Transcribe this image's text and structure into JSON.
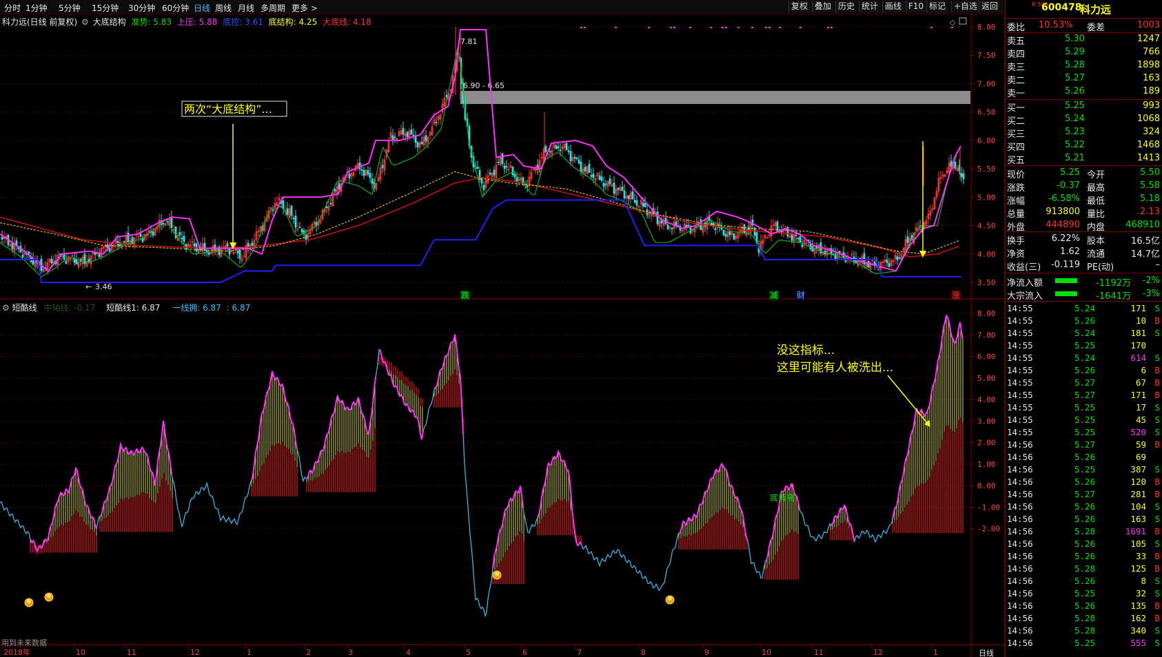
{
  "toolbar": {
    "periods": [
      "分时",
      "1分钟",
      "5分钟",
      "15分钟",
      "30分钟",
      "60分钟",
      "日线",
      "周线",
      "月线",
      "多周期",
      "更多 >"
    ],
    "active_period": "日线",
    "right_buttons": [
      "复权",
      "叠加",
      "历史",
      "统计",
      "画线",
      "F10",
      "标记",
      "+自选",
      "返回"
    ]
  },
  "main_chart": {
    "title": "科力远(日线 前复权)",
    "indicator_name": "大底结构",
    "indicators": [
      {
        "label": "准势: 5.83",
        "color": "#00e000"
      },
      {
        "label": "上压: 5.88",
        "color": "#ff30ff"
      },
      {
        "label": "底控: 3.61",
        "color": "#3050ff"
      },
      {
        "label": "底结构: 4.25",
        "color": "#ffff00"
      },
      {
        "label": "大底线: 4.18",
        "color": "#ff3030"
      }
    ],
    "price_axis": [
      "8.00",
      "7.50",
      "7.00",
      "6.50",
      "6.00",
      "5.50",
      "5.00",
      "4.50",
      "4.00",
      "3.50"
    ],
    "annotation_box": "两次“大底结构”...",
    "high_label": "7.81",
    "low_label": "3.46",
    "zone_label": "6.90 - 6.65",
    "event_labels": [
      "跌",
      "减",
      "财",
      "涨"
    ]
  },
  "sub_chart": {
    "name": "短酷线",
    "legend": [
      {
        "label": "中轴线: -0.17",
        "color": "#2a4a2a"
      },
      {
        "label": "短酷线1: 6.87",
        "color": "#e6e6e6"
      },
      {
        "label": "一线拥: 6.87",
        "color": "#30c0ff"
      },
      {
        "label": ": 6.87",
        "color": "#30c0ff"
      }
    ],
    "axis": [
      "8.00",
      "7.00",
      "6.00",
      "5.00",
      "4.00",
      "3.00",
      "2.00",
      "1.00",
      "0.00",
      "-1.00",
      "-2.00"
    ],
    "annotation": [
      "没这指标...",
      "这里可能有人被洗出..."
    ],
    "marker_label": "底背离",
    "footer_note": "用到未来数据"
  },
  "time_axis": [
    "2018年",
    "10",
    "11",
    "12",
    "1",
    "2",
    "3",
    "4",
    "5",
    "6",
    "7",
    "8",
    "9",
    "10",
    "11",
    "12",
    "1"
  ],
  "time_axis_right": "日线",
  "quote": {
    "code": "600478",
    "name": "科力远",
    "badge": "R 500",
    "weibi_label": "委比",
    "weibi": "10.53%",
    "weicha_label": "委差",
    "weicha": "1003",
    "asks": [
      {
        "label": "卖五",
        "price": "5.30",
        "vol": "1247"
      },
      {
        "label": "卖四",
        "price": "5.29",
        "vol": "766"
      },
      {
        "label": "卖三",
        "price": "5.28",
        "vol": "1898"
      },
      {
        "label": "卖二",
        "price": "5.27",
        "vol": "163"
      },
      {
        "label": "卖一",
        "price": "5.26",
        "vol": "189"
      }
    ],
    "bids": [
      {
        "label": "买一",
        "price": "5.25",
        "vol": "993"
      },
      {
        "label": "买二",
        "price": "5.24",
        "vol": "1068"
      },
      {
        "label": "买三",
        "price": "5.23",
        "vol": "324"
      },
      {
        "label": "买四",
        "price": "5.22",
        "vol": "1468"
      },
      {
        "label": "买五",
        "price": "5.21",
        "vol": "1413"
      }
    ],
    "stats": [
      {
        "l1": "现价",
        "v1": "5.25",
        "c1": "green",
        "l2": "今开",
        "v2": "5.50",
        "c2": "green"
      },
      {
        "l1": "涨跌",
        "v1": "-0.37",
        "c1": "green",
        "l2": "最高",
        "v2": "5.58",
        "c2": "green"
      },
      {
        "l1": "涨幅",
        "v1": "-6.58%",
        "c1": "green",
        "l2": "最低",
        "v2": "5.18",
        "c2": "green"
      },
      {
        "l1": "总量",
        "v1": "913800",
        "c1": "yellow",
        "l2": "量比",
        "v2": "2.13",
        "c2": "red"
      },
      {
        "l1": "外盘",
        "v1": "444890",
        "c1": "red",
        "l2": "内盘",
        "v2": "468910",
        "c2": "green"
      }
    ],
    "stats2": [
      {
        "l1": "换手",
        "v1": "6.22%",
        "l2": "股本",
        "v2": "16.5亿"
      },
      {
        "l1": "净资",
        "v1": "1.62",
        "l2": "流通",
        "v2": "14.7亿"
      },
      {
        "l1": "收益(三)",
        "v1": "-0.119",
        "l2": "PE(动)",
        "v2": "–"
      }
    ],
    "flows": [
      {
        "label": "净流入额",
        "value": "-1192万",
        "pct": "-2%"
      },
      {
        "label": "大宗流入",
        "value": "-1641万",
        "pct": "-3%"
      }
    ],
    "ticks": [
      {
        "t": "14:55",
        "p": "5.24",
        "v": "171",
        "s": "S"
      },
      {
        "t": "14:55",
        "p": "5.26",
        "v": "10",
        "s": "B"
      },
      {
        "t": "14:55",
        "p": "5.24",
        "v": "181",
        "s": "S"
      },
      {
        "t": "14:55",
        "p": "5.25",
        "v": "170",
        "s": ""
      },
      {
        "t": "14:55",
        "p": "5.24",
        "v": "614",
        "s": "S"
      },
      {
        "t": "14:55",
        "p": "5.26",
        "v": "6",
        "s": "B"
      },
      {
        "t": "14:55",
        "p": "5.27",
        "v": "67",
        "s": "B"
      },
      {
        "t": "14:55",
        "p": "5.27",
        "v": "171",
        "s": "B"
      },
      {
        "t": "14:55",
        "p": "5.25",
        "v": "17",
        "s": "S"
      },
      {
        "t": "14:55",
        "p": "5.25",
        "v": "45",
        "s": "S"
      },
      {
        "t": "14:55",
        "p": "5.25",
        "v": "520",
        "s": "S"
      },
      {
        "t": "14:56",
        "p": "5.27",
        "v": "59",
        "s": "B"
      },
      {
        "t": "14:56",
        "p": "5.26",
        "v": "69",
        "s": ""
      },
      {
        "t": "14:56",
        "p": "5.25",
        "v": "387",
        "s": "S"
      },
      {
        "t": "14:56",
        "p": "5.26",
        "v": "120",
        "s": "B"
      },
      {
        "t": "14:56",
        "p": "5.27",
        "v": "281",
        "s": "B"
      },
      {
        "t": "14:56",
        "p": "5.26",
        "v": "104",
        "s": "S"
      },
      {
        "t": "14:56",
        "p": "5.26",
        "v": "163",
        "s": "S"
      },
      {
        "t": "14:56",
        "p": "5.28",
        "v": "1691",
        "s": "B"
      },
      {
        "t": "14:56",
        "p": "5.26",
        "v": "105",
        "s": "S"
      },
      {
        "t": "14:56",
        "p": "5.26",
        "v": "33",
        "s": "B"
      },
      {
        "t": "14:56",
        "p": "5.28",
        "v": "125",
        "s": "B"
      },
      {
        "t": "14:56",
        "p": "5.26",
        "v": "8",
        "s": "S"
      },
      {
        "t": "14:56",
        "p": "5.25",
        "v": "32",
        "s": "S"
      },
      {
        "t": "14:56",
        "p": "5.26",
        "v": "135",
        "s": "B"
      },
      {
        "t": "14:56",
        "p": "5.28",
        "v": "162",
        "s": "B"
      },
      {
        "t": "14:56",
        "p": "5.28",
        "v": "340",
        "s": "S"
      },
      {
        "t": "14:56",
        "p": "5.25",
        "v": "555",
        "s": "S"
      }
    ]
  }
}
